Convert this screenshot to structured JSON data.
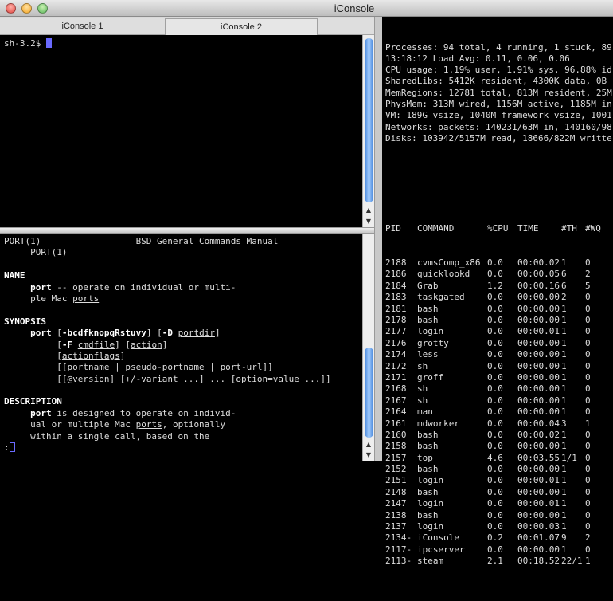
{
  "window": {
    "title": "iConsole"
  },
  "tabs": [
    {
      "label": "iConsole 1"
    },
    {
      "label": "iConsole 2"
    }
  ],
  "top_terminal": {
    "prompt": "sh-3.2$ "
  },
  "man_page": {
    "lines": [
      [
        {
          "t": "PORT(1)                  BSD General Commands Manual",
          "s": ""
        }
      ],
      [
        {
          "t": "     PORT(1)",
          "s": ""
        }
      ],
      [
        {
          "t": "",
          "s": ""
        }
      ],
      [
        {
          "t": "NAME",
          "s": "b"
        }
      ],
      [
        {
          "t": "     ",
          "s": ""
        },
        {
          "t": "port",
          "s": "b"
        },
        {
          "t": " -- operate on individual or multi-",
          "s": ""
        }
      ],
      [
        {
          "t": "     ple Mac ",
          "s": ""
        },
        {
          "t": "ports",
          "s": "u"
        }
      ],
      [
        {
          "t": "",
          "s": ""
        }
      ],
      [
        {
          "t": "SYNOPSIS",
          "s": "b"
        }
      ],
      [
        {
          "t": "     ",
          "s": ""
        },
        {
          "t": "port",
          "s": "b"
        },
        {
          "t": " [",
          "s": ""
        },
        {
          "t": "-bcdfknopqRstuvy",
          "s": "b"
        },
        {
          "t": "] [",
          "s": ""
        },
        {
          "t": "-D",
          "s": "b"
        },
        {
          "t": " ",
          "s": ""
        },
        {
          "t": "portdir",
          "s": "u"
        },
        {
          "t": "]",
          "s": ""
        }
      ],
      [
        {
          "t": "          [",
          "s": ""
        },
        {
          "t": "-F",
          "s": "b"
        },
        {
          "t": " ",
          "s": ""
        },
        {
          "t": "cmdfile",
          "s": "u"
        },
        {
          "t": "] [",
          "s": ""
        },
        {
          "t": "action",
          "s": "u"
        },
        {
          "t": "]",
          "s": ""
        }
      ],
      [
        {
          "t": "          [",
          "s": ""
        },
        {
          "t": "actionflags",
          "s": "u"
        },
        {
          "t": "]",
          "s": ""
        }
      ],
      [
        {
          "t": "          [[",
          "s": ""
        },
        {
          "t": "portname",
          "s": "u"
        },
        {
          "t": " | ",
          "s": ""
        },
        {
          "t": "pseudo-portname",
          "s": "u"
        },
        {
          "t": " | ",
          "s": ""
        },
        {
          "t": "port-url",
          "s": "u"
        },
        {
          "t": "]]",
          "s": ""
        }
      ],
      [
        {
          "t": "          [[",
          "s": ""
        },
        {
          "t": "@version",
          "s": "u"
        },
        {
          "t": "] [+/-variant ...] ... [option=value ...]]",
          "s": ""
        }
      ],
      [
        {
          "t": "",
          "s": ""
        }
      ],
      [
        {
          "t": "DESCRIPTION",
          "s": "b"
        }
      ],
      [
        {
          "t": "     ",
          "s": ""
        },
        {
          "t": "port",
          "s": "b"
        },
        {
          "t": " is designed to operate on individ-",
          "s": ""
        }
      ],
      [
        {
          "t": "     ual or multiple Mac ",
          "s": ""
        },
        {
          "t": "ports",
          "s": "u"
        },
        {
          "t": ", optionally",
          "s": ""
        }
      ],
      [
        {
          "t": "     within a single call, based on the",
          "s": ""
        }
      ]
    ],
    "pager_prompt": ":"
  },
  "top_summary": [
    "Processes: 94 total, 4 running, 1 stuck, 89",
    "13:18:12 Load Avg: 0.11, 0.06, 0.06",
    "CPU usage: 1.19% user, 1.91% sys, 96.88% id",
    "SharedLibs: 5412K resident, 4300K data, 0B",
    "MemRegions: 12781 total, 813M resident, 25M",
    "PhysMem: 313M wired, 1156M active, 1185M in",
    "VM: 189G vsize, 1040M framework vsize, 1001",
    "Networks: packets: 140231/63M in, 140160/98",
    "Disks: 103942/5157M read, 18666/822M writte"
  ],
  "process_table": {
    "columns": [
      "PID",
      "COMMAND",
      "%CPU",
      "TIME",
      "#TH",
      "#WQ"
    ],
    "rows": [
      [
        "2188",
        "cvmsComp_x86",
        "0.0",
        "00:00.02",
        "1",
        "0"
      ],
      [
        "2186",
        "quicklookd",
        "0.0",
        "00:00.05",
        "6",
        "2"
      ],
      [
        "2184",
        "Grab",
        "1.2",
        "00:00.16",
        "6",
        "5"
      ],
      [
        "2183",
        "taskgated",
        "0.0",
        "00:00.00",
        "2",
        "0"
      ],
      [
        "2181",
        "bash",
        "0.0",
        "00:00.00",
        "1",
        "0"
      ],
      [
        "2178",
        "bash",
        "0.0",
        "00:00.00",
        "1",
        "0"
      ],
      [
        "2177",
        "login",
        "0.0",
        "00:00.01",
        "1",
        "0"
      ],
      [
        "2176",
        "grotty",
        "0.0",
        "00:00.00",
        "1",
        "0"
      ],
      [
        "2174",
        "less",
        "0.0",
        "00:00.00",
        "1",
        "0"
      ],
      [
        "2172",
        "sh",
        "0.0",
        "00:00.00",
        "1",
        "0"
      ],
      [
        "2171",
        "groff",
        "0.0",
        "00:00.00",
        "1",
        "0"
      ],
      [
        "2168",
        "sh",
        "0.0",
        "00:00.00",
        "1",
        "0"
      ],
      [
        "2167",
        "sh",
        "0.0",
        "00:00.00",
        "1",
        "0"
      ],
      [
        "2164",
        "man",
        "0.0",
        "00:00.00",
        "1",
        "0"
      ],
      [
        "2161",
        "mdworker",
        "0.0",
        "00:00.04",
        "3",
        "1"
      ],
      [
        "2160",
        "bash",
        "0.0",
        "00:00.02",
        "1",
        "0"
      ],
      [
        "2158",
        "bash",
        "0.0",
        "00:00.00",
        "1",
        "0"
      ],
      [
        "2157",
        "top",
        "4.6",
        "00:03.55",
        "1/1",
        "0"
      ],
      [
        "2152",
        "bash",
        "0.0",
        "00:00.00",
        "1",
        "0"
      ],
      [
        "2151",
        "login",
        "0.0",
        "00:00.01",
        "1",
        "0"
      ],
      [
        "2148",
        "bash",
        "0.0",
        "00:00.00",
        "1",
        "0"
      ],
      [
        "2147",
        "login",
        "0.0",
        "00:00.01",
        "1",
        "0"
      ],
      [
        "2138",
        "bash",
        "0.0",
        "00:00.00",
        "1",
        "0"
      ],
      [
        "2137",
        "login",
        "0.0",
        "00:00.03",
        "1",
        "0"
      ],
      [
        "2134-",
        "iConsole",
        "0.2",
        "00:01.07",
        "9",
        "2"
      ],
      [
        "2117-",
        "ipcserver",
        "0.0",
        "00:00.00",
        "1",
        "0"
      ],
      [
        "2113-",
        "steam",
        "2.1",
        "00:18.52",
        "22/1",
        "1"
      ]
    ]
  },
  "colors": {
    "close": "#e0443e",
    "minimize": "#f5a623",
    "zoom": "#5cb85c",
    "cursor": "#6a6aff"
  }
}
